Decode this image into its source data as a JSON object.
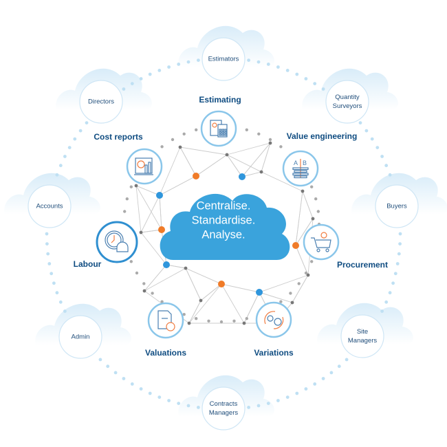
{
  "center": {
    "lines": [
      "Centralise.",
      "Standardise.",
      "Analyse."
    ]
  },
  "colors": {
    "cloud_center": "#3aa3dc",
    "label_dark": "#0f4c81",
    "role_text": "#1f4d7a",
    "icon_ring": "#8ac6ea",
    "icon_ring_active": "#2f8fd0",
    "icon_line": "#4a7fb0",
    "icon_accent": "#f07b3f",
    "node_orange": "#f07b28",
    "node_blue": "#2f96dc",
    "node_grey": "#777777",
    "orbit_dot": "#bfe0f3"
  },
  "roles": [
    {
      "id": "estimators",
      "label": "Estimators"
    },
    {
      "id": "quantity-surveyors",
      "label": "Quantity Surveyors"
    },
    {
      "id": "buyers",
      "label": "Buyers"
    },
    {
      "id": "site-managers",
      "label": "Site Managers"
    },
    {
      "id": "contracts-managers",
      "label": "Contracts Managers"
    },
    {
      "id": "admin",
      "label": "Admin"
    },
    {
      "id": "accounts",
      "label": "Accounts"
    },
    {
      "id": "directors",
      "label": "Directors"
    }
  ],
  "functions": [
    {
      "id": "estimating",
      "label": "Estimating",
      "icon": "calculator-document-icon"
    },
    {
      "id": "value-engineering",
      "label": "Value engineering",
      "icon": "ab-comparison-icon"
    },
    {
      "id": "procurement",
      "label": "Procurement",
      "icon": "shopping-cart-icon"
    },
    {
      "id": "variations",
      "label": "Variations",
      "icon": "gear-pound-cycle-icon"
    },
    {
      "id": "valuations",
      "label": "Valuations",
      "icon": "document-pound-icon"
    },
    {
      "id": "labour",
      "label": "Labour",
      "icon": "clock-hardhat-icon"
    },
    {
      "id": "cost-reports",
      "label": "Cost reports",
      "icon": "report-chart-icon"
    }
  ]
}
